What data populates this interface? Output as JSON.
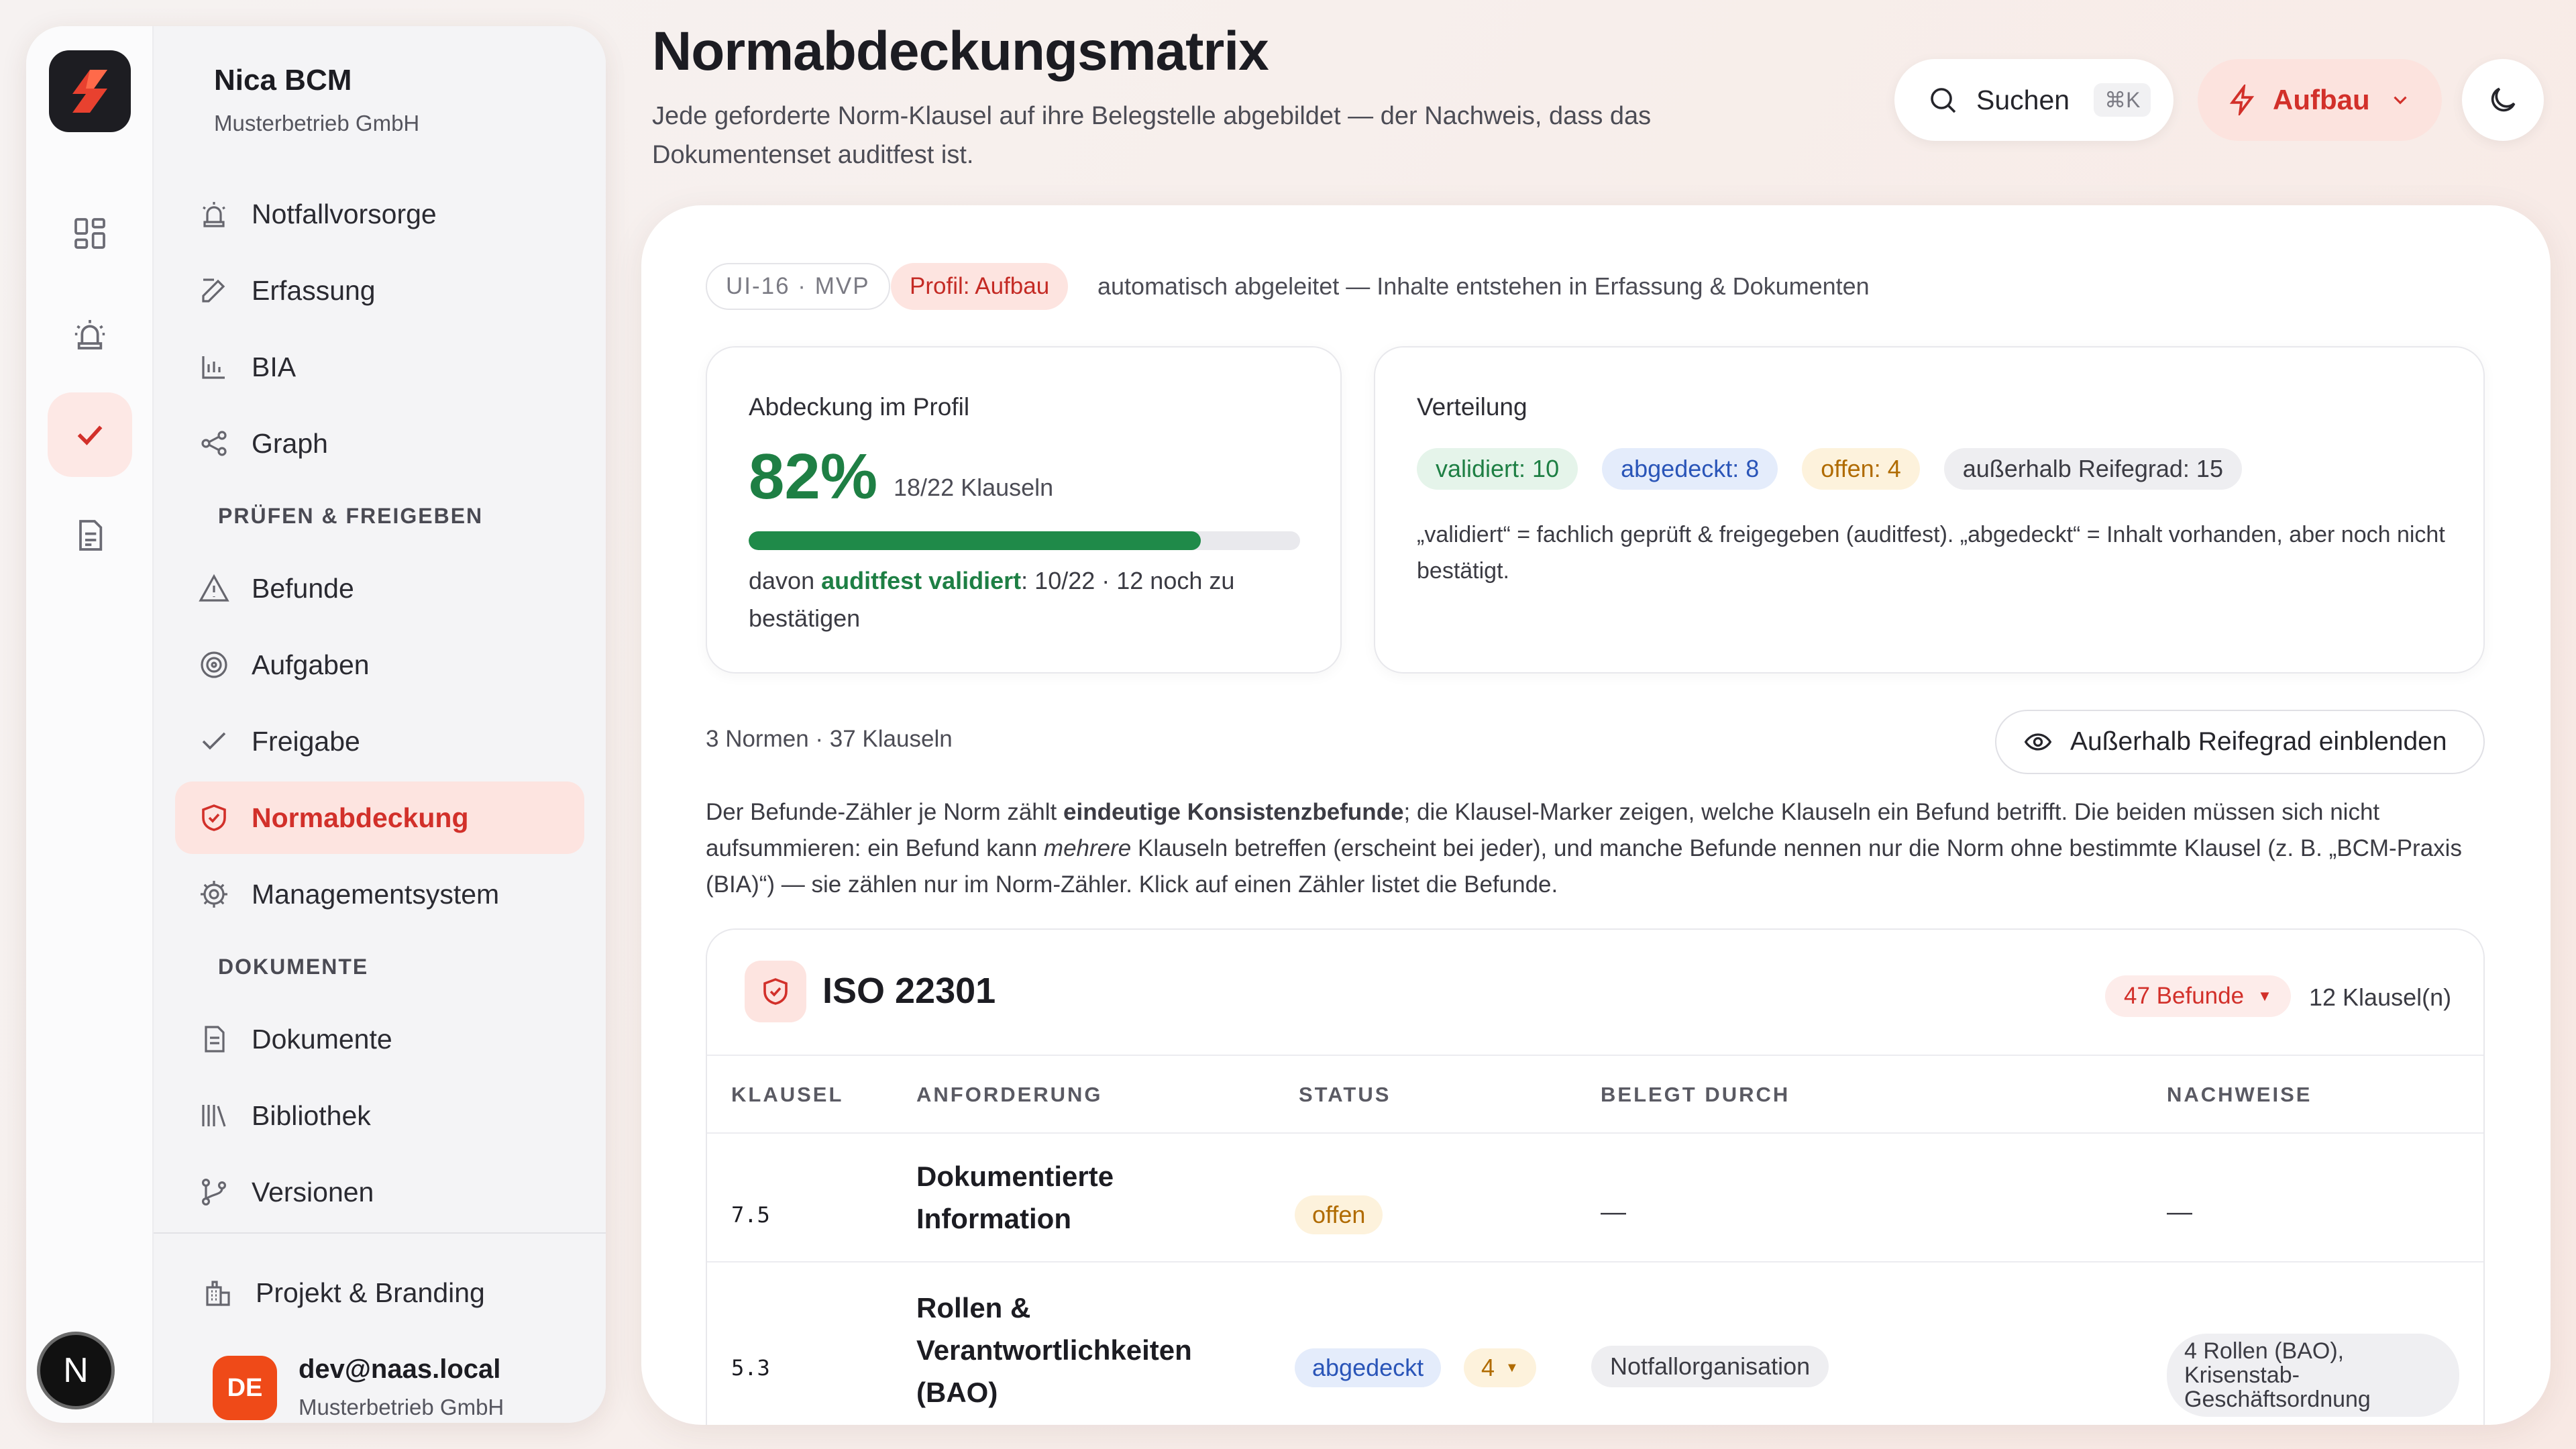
{
  "sidebar": {
    "brand_title": "Nica BCM",
    "brand_sub": "Musterbetrieb GmbH",
    "items": [
      {
        "label": "Notfallvorsorge"
      },
      {
        "label": "Erfassung"
      },
      {
        "label": "BIA"
      },
      {
        "label": "Graph"
      },
      {
        "label": "Befunde"
      },
      {
        "label": "Aufgaben"
      },
      {
        "label": "Freigabe"
      },
      {
        "label": "Normabdeckung"
      },
      {
        "label": "Managementsystem"
      },
      {
        "label": "Dokumente"
      },
      {
        "label": "Bibliothek"
      },
      {
        "label": "Versionen"
      },
      {
        "label": "Projekt & Branding"
      }
    ],
    "section_pruefen": "PRÜFEN & FREIGEBEN",
    "section_dokumente": "DOKUMENTE",
    "user_initials": "DE",
    "user_mail": "dev@naas.local",
    "user_org": "Musterbetrieb GmbH",
    "rail_badge": "N"
  },
  "header": {
    "title": "Normabdeckungsmatrix",
    "subtitle": "Jede geforderte Norm-Klausel auf ihre Belegstelle abgebildet — der Nachweis, dass das Dokumentenset auditfest ist.",
    "search_label": "Suchen",
    "search_kbd": "⌘K",
    "profile_label": "Aufbau"
  },
  "tags": {
    "ui": "UI-16 · MVP",
    "profil": "Profil: Aufbau",
    "desc": "automatisch abgeleitet — Inhalte entstehen in Erfassung & Dokumenten"
  },
  "coverage": {
    "label": "Abdeckung im Profil",
    "percent": "82%",
    "fraction_value": 0.82,
    "klauseln": "18/22 Klauseln",
    "note_prefix": "davon ",
    "note_bold": "auditfest validiert",
    "note_suffix": ": 10/22 · 12 noch zu bestätigen"
  },
  "distribution": {
    "label": "Verteilung",
    "validiert": "validiert: 10",
    "abgedeckt": "abgedeckt: 8",
    "offen": "offen: 4",
    "ausserhalb": "außerhalb Reifegrad: 15",
    "note": "„validiert“ = fachlich geprüft & freigegeben (auditfest). „abgedeckt“ = Inhalt vorhanden, aber noch nicht bestätigt."
  },
  "summary": {
    "counts": "3 Normen · 37 Klauseln",
    "toggle_label": "Außerhalb Reifegrad einblenden",
    "explain_1": "Der Befunde-Zähler je Norm zählt ",
    "explain_bold": "eindeutige Konsistenzbefunde",
    "explain_2": "; die Klausel-Marker zeigen, welche Klauseln ein Befund betrifft. Die beiden müssen sich nicht aufsummieren: ein Befund kann ",
    "explain_italic": "mehrere",
    "explain_3": " Klauseln betreffen (erscheint bei jeder), und manche Befunde nennen nur die Norm ohne bestimmte Klausel (z. B. „BCM-Praxis (BIA)“) — sie zählen nur im Norm-Zähler. Klick auf einen Zähler listet die Befunde."
  },
  "norm": {
    "title": "ISO 22301",
    "befunde": "47 Befunde",
    "klauseln": "12 Klausel(n)",
    "columns": [
      "KLAUSEL",
      "ANFORDERUNG",
      "STATUS",
      "BELEGT DURCH",
      "NACHWEISE"
    ],
    "rows": [
      {
        "code": "7.5",
        "req": "Dokumentierte Information",
        "status": "offen",
        "belegt": "—",
        "nachweise": "—"
      },
      {
        "code": "5.3",
        "req": "Rollen & Verantwortlichkeiten (BAO)",
        "status": "abgedeckt",
        "befunde_count": "4",
        "belegt": "Notfallorganisation",
        "nachweise": "4 Rollen (BAO), Krisenstab-Geschäftsordnung"
      }
    ]
  },
  "colors": {
    "accent": "#d2302a",
    "green": "#1e7f44",
    "blue": "#2a55b8",
    "amber": "#b06b00"
  }
}
